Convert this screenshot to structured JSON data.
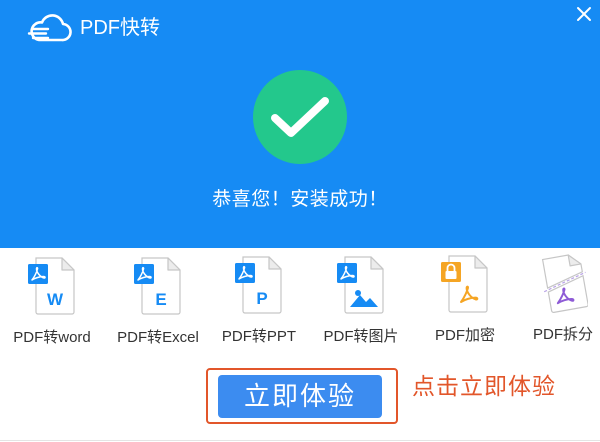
{
  "app": {
    "title": "PDF快转"
  },
  "status": {
    "message": "恭喜您！安装成功！"
  },
  "features": [
    {
      "label": "PDF转word",
      "letter": "W",
      "icon": "word-document-icon"
    },
    {
      "label": "PDF转Excel",
      "letter": "E",
      "icon": "excel-document-icon"
    },
    {
      "label": "PDF转PPT",
      "letter": "P",
      "icon": "ppt-document-icon"
    },
    {
      "label": "PDF转图片",
      "icon": "image-document-icon"
    },
    {
      "label": "PDF加密",
      "icon": "lock-document-icon"
    },
    {
      "label": "PDF拆分",
      "icon": "split-document-icon"
    }
  ],
  "cta": {
    "button_label": "立即体验",
    "hint": "点击立即体验"
  },
  "icons": {
    "logo": "cloud-logo-icon",
    "close": "close-icon",
    "success": "checkmark-icon"
  },
  "colors": {
    "brand": "#168bf4",
    "button": "#3c8cf0",
    "success": "#23c88c",
    "highlight": "#e2562a",
    "lock": "#f5a524",
    "split": "#8e5bd6"
  }
}
